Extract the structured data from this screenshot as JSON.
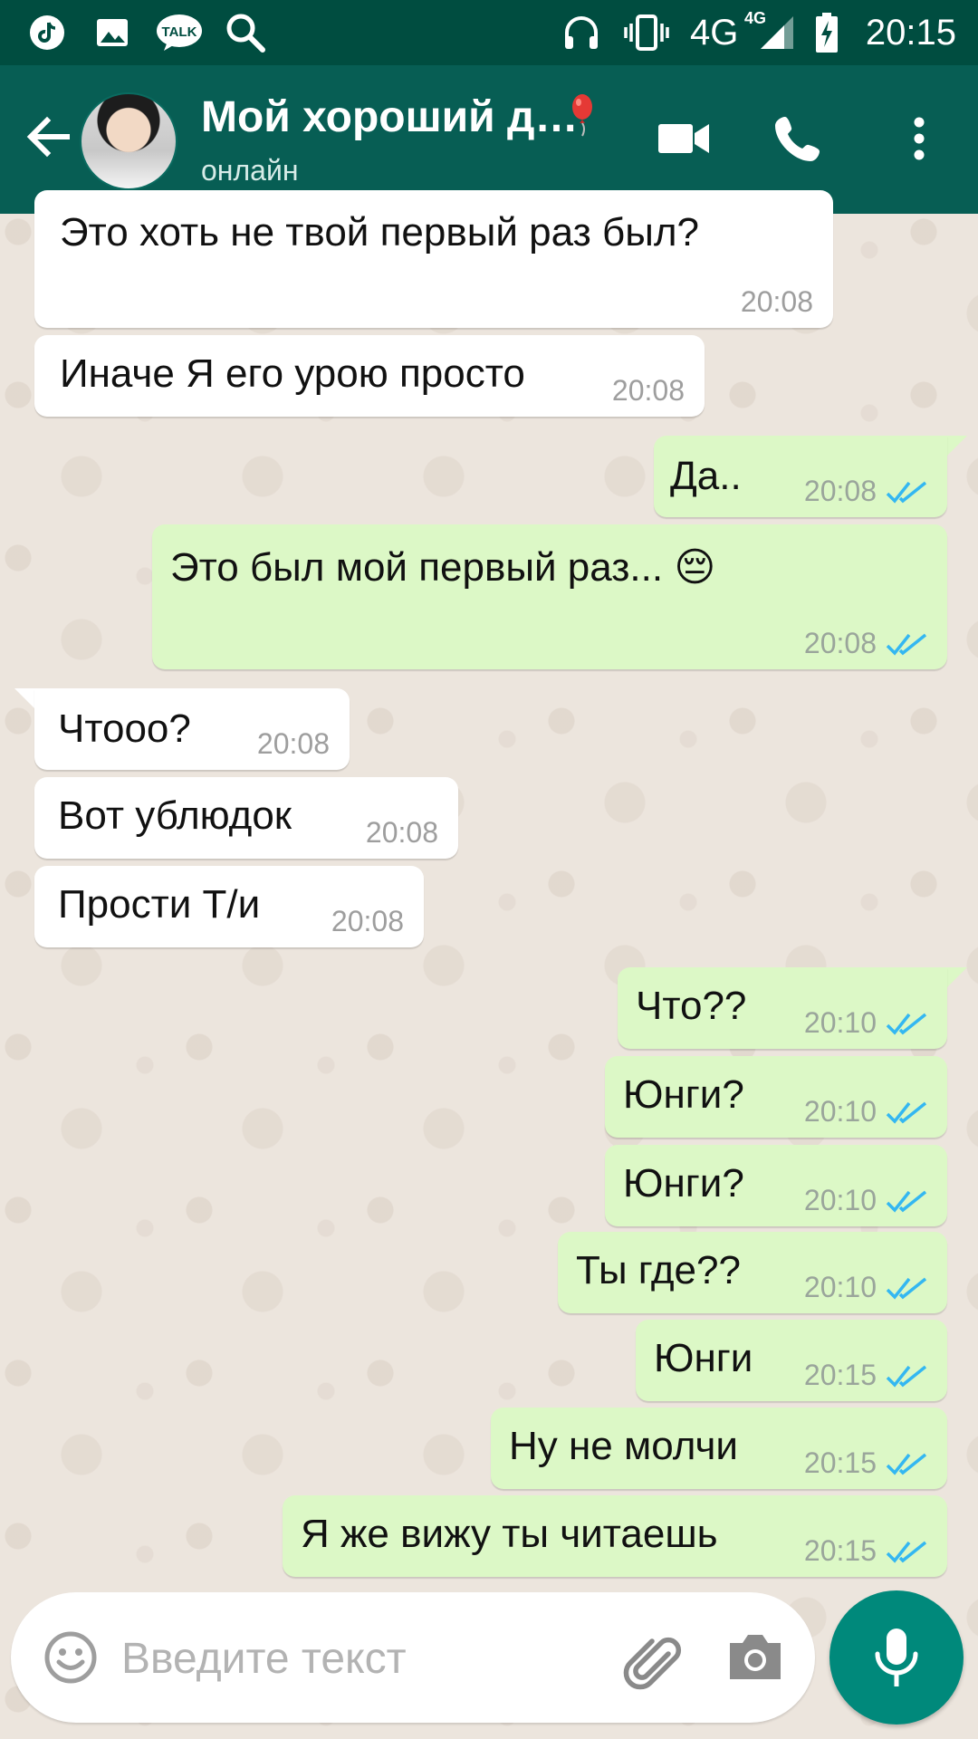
{
  "status_bar": {
    "network": "4G",
    "network_small": "4G",
    "time": "20:15",
    "icons": [
      "tiktok-icon",
      "gallery-icon",
      "kakaotalk-icon",
      "search-icon",
      "headphones-icon",
      "vibrate-icon",
      "signal-icon",
      "battery-charging-icon"
    ],
    "kakao_label": "TALK"
  },
  "header": {
    "contact_name": "Мой хороший д…",
    "contact_status": "онлайн",
    "icons": [
      "back-arrow-icon",
      "balloon-icon",
      "video-call-icon",
      "phone-icon",
      "more-vert-icon"
    ]
  },
  "messages": [
    {
      "direction": "in",
      "text": "Это хоть не твой первый раз был?",
      "time": "20:08"
    },
    {
      "direction": "in",
      "text": "Иначе Я его урою просто",
      "time": "20:08"
    },
    {
      "direction": "out",
      "text": "Да..",
      "time": "20:08",
      "status": "read"
    },
    {
      "direction": "out",
      "text": "Это был мой первый раз... 😔",
      "time": "20:08",
      "status": "read"
    },
    {
      "direction": "in",
      "text": "Чтооо?",
      "time": "20:08"
    },
    {
      "direction": "in",
      "text": "Вот ублюдок",
      "time": "20:08"
    },
    {
      "direction": "in",
      "text": "Прости Т/и",
      "time": "20:08"
    },
    {
      "direction": "out",
      "text": "Что??",
      "time": "20:10",
      "status": "read"
    },
    {
      "direction": "out",
      "text": "Юнги?",
      "time": "20:10",
      "status": "read"
    },
    {
      "direction": "out",
      "text": "Юнги?",
      "time": "20:10",
      "status": "read"
    },
    {
      "direction": "out",
      "text": "Ты где??",
      "time": "20:10",
      "status": "read"
    },
    {
      "direction": "out",
      "text": "Юнги",
      "time": "20:15",
      "status": "read"
    },
    {
      "direction": "out",
      "text": "Ну не молчи",
      "time": "20:15",
      "status": "read"
    },
    {
      "direction": "out",
      "text": "Я же вижу ты читаешь",
      "time": "20:15",
      "status": "read"
    }
  ],
  "composer": {
    "placeholder": "Введите текст",
    "icons": [
      "emoji-icon",
      "paperclip-icon",
      "camera-icon",
      "microphone-icon"
    ]
  },
  "colors": {
    "header": "#075e54",
    "status_bar": "#004d40",
    "incoming_bubble": "#ffffff",
    "outgoing_bubble": "#dcf8c6",
    "read_ticks": "#34b7f1",
    "mic_button": "#00897b"
  }
}
